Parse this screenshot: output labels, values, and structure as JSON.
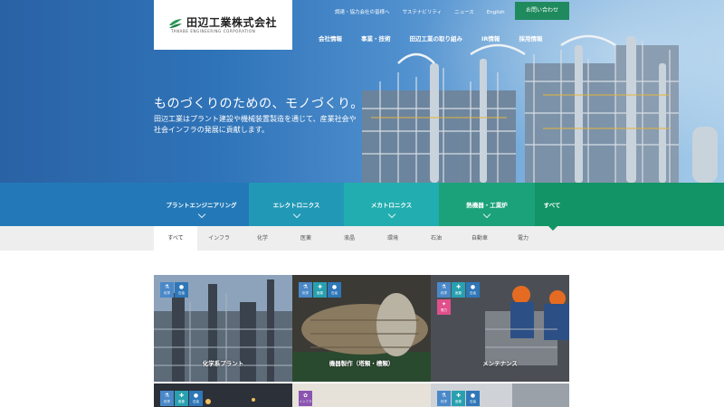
{
  "header": {
    "company_name": "田辺工業株式会社",
    "company_name_en": "TANABE ENGINEERING CORPORATION",
    "utility_links": [
      "調達・協力会社の皆様へ",
      "サステナビリティ",
      "ニュース",
      "English"
    ],
    "contact_label": "お問い合わせ",
    "main_nav": [
      "会社情報",
      "事業・技術",
      "田辺工業の取り組み",
      "IR情報",
      "採用情報"
    ]
  },
  "hero": {
    "tagline": "ものづくりのための、モノづくり。",
    "lead": "田辺工業はプラント建設や機械装置製造を通じて、産業社会や社会インフラの発展に貢献します。"
  },
  "categories": [
    {
      "label": "プラントエンジニアリング",
      "color": "#2379b7"
    },
    {
      "label": "エレクトロニクス",
      "color": "#2199b6"
    },
    {
      "label": "メカトロニクス",
      "color": "#22aeb0"
    },
    {
      "label": "熱機器・工業炉",
      "color": "#1ca27a"
    },
    {
      "label": "すべて",
      "color": "#139466"
    }
  ],
  "filters": [
    "すべて",
    "インフラ",
    "化学",
    "医薬",
    "液晶",
    "環境",
    "石油",
    "自動車",
    "電力"
  ],
  "cards": [
    {
      "title": "化学系プラント",
      "badges": [
        {
          "icon": "flask-icon",
          "label": "化学",
          "cls": "b-chem"
        },
        {
          "icon": "oil-drop-icon",
          "label": "石油",
          "cls": "b-oil"
        }
      ]
    },
    {
      "title": "機器製作（塔類・槽類）",
      "badges": [
        {
          "icon": "flask-icon",
          "label": "化学",
          "cls": "b-chem"
        },
        {
          "icon": "medicine-icon",
          "label": "医薬",
          "cls": "b-env"
        },
        {
          "icon": "oil-drop-icon",
          "label": "石油",
          "cls": "b-oil"
        }
      ]
    },
    {
      "title": "メンテナンス",
      "badges": [
        {
          "icon": "flask-icon",
          "label": "化学",
          "cls": "b-chem"
        },
        {
          "icon": "medicine-icon",
          "label": "医薬",
          "cls": "b-env"
        },
        {
          "icon": "oil-drop-icon",
          "label": "石油",
          "cls": "b-oil"
        },
        {
          "icon": "power-icon",
          "label": "電力",
          "cls": "b-power"
        }
      ]
    },
    {
      "title": "",
      "badges": [
        {
          "icon": "flask-icon",
          "label": "化学",
          "cls": "b-chem"
        },
        {
          "icon": "medicine-icon",
          "label": "医薬",
          "cls": "b-env"
        },
        {
          "icon": "oil-drop-icon",
          "label": "石油",
          "cls": "b-oil"
        }
      ]
    },
    {
      "title": "",
      "badges": [
        {
          "icon": "gear-icon",
          "label": "インフラ",
          "cls": "b-infra"
        }
      ]
    },
    {
      "title": "",
      "badges": [
        {
          "icon": "flask-icon",
          "label": "化学",
          "cls": "b-chem"
        },
        {
          "icon": "medicine-icon",
          "label": "医薬",
          "cls": "b-env"
        },
        {
          "icon": "oil-drop-icon",
          "label": "石油",
          "cls": "b-oil"
        }
      ]
    }
  ]
}
